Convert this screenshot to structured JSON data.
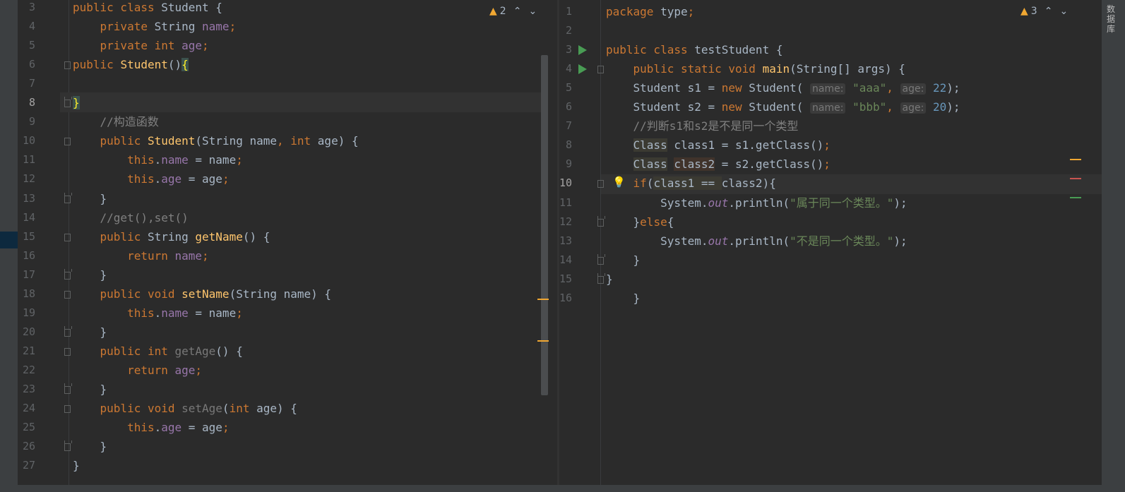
{
  "left_editor": {
    "warning_count": "2",
    "lines": [
      {
        "n": "3",
        "segs": [
          [
            "kw",
            "public class "
          ],
          [
            "",
            "Student {"
          ]
        ]
      },
      {
        "n": "4",
        "segs": [
          [
            "",
            "    "
          ],
          [
            "kw",
            "private "
          ],
          [
            "",
            "String "
          ],
          [
            "fld",
            "name"
          ],
          [
            "kw",
            ";"
          ]
        ]
      },
      {
        "n": "5",
        "segs": [
          [
            "",
            "    "
          ],
          [
            "kw",
            "private int "
          ],
          [
            "fld",
            "age"
          ],
          [
            "kw",
            ";"
          ]
        ]
      },
      {
        "n": "6",
        "segs": [
          [
            "kw",
            "public "
          ],
          [
            "fn",
            "Student"
          ],
          [
            "",
            "()"
          ],
          [
            "brace-hl",
            "{"
          ]
        ]
      },
      {
        "n": "7",
        "segs": [
          [
            "",
            ""
          ]
        ]
      },
      {
        "n": "8",
        "segs": [
          [
            "brace-hl",
            "}"
          ]
        ]
      },
      {
        "n": "9",
        "segs": [
          [
            "",
            "    "
          ],
          [
            "cm",
            "//构造函数"
          ]
        ]
      },
      {
        "n": "10",
        "segs": [
          [
            "",
            "    "
          ],
          [
            "kw",
            "public "
          ],
          [
            "fn",
            "Student"
          ],
          [
            "",
            "(String name"
          ],
          [
            "kw",
            ", int "
          ],
          [
            "",
            "age) {"
          ]
        ]
      },
      {
        "n": "11",
        "segs": [
          [
            "",
            "        "
          ],
          [
            "kw",
            "this"
          ],
          [
            "",
            "."
          ],
          [
            "fld",
            "name"
          ],
          [
            "",
            " = name"
          ],
          [
            "kw",
            ";"
          ]
        ]
      },
      {
        "n": "12",
        "segs": [
          [
            "",
            "        "
          ],
          [
            "kw",
            "this"
          ],
          [
            "",
            "."
          ],
          [
            "fld",
            "age"
          ],
          [
            "",
            " = age"
          ],
          [
            "kw",
            ";"
          ]
        ]
      },
      {
        "n": "13",
        "segs": [
          [
            "",
            "    }"
          ]
        ]
      },
      {
        "n": "14",
        "segs": [
          [
            "",
            "    "
          ],
          [
            "cm",
            "//get(),set()"
          ]
        ]
      },
      {
        "n": "15",
        "segs": [
          [
            "",
            "    "
          ],
          [
            "kw",
            "public "
          ],
          [
            "",
            "String "
          ],
          [
            "fn",
            "getName"
          ],
          [
            "",
            "() {"
          ]
        ]
      },
      {
        "n": "16",
        "segs": [
          [
            "",
            "        "
          ],
          [
            "kw",
            "return "
          ],
          [
            "fld",
            "name"
          ],
          [
            "kw",
            ";"
          ]
        ]
      },
      {
        "n": "17",
        "segs": [
          [
            "",
            "    }"
          ]
        ]
      },
      {
        "n": "18",
        "segs": [
          [
            "",
            "    "
          ],
          [
            "kw",
            "public void "
          ],
          [
            "fn",
            "setName"
          ],
          [
            "",
            "(String name) {"
          ]
        ]
      },
      {
        "n": "19",
        "segs": [
          [
            "",
            "        "
          ],
          [
            "kw",
            "this"
          ],
          [
            "",
            "."
          ],
          [
            "fld",
            "name"
          ],
          [
            "",
            " = name"
          ],
          [
            "kw",
            ";"
          ]
        ]
      },
      {
        "n": "20",
        "segs": [
          [
            "",
            "    }"
          ]
        ]
      },
      {
        "n": "21",
        "segs": [
          [
            "",
            "    "
          ],
          [
            "kw",
            "public int "
          ],
          [
            "gr",
            "getAge"
          ],
          [
            "",
            "() {"
          ]
        ]
      },
      {
        "n": "22",
        "segs": [
          [
            "",
            "        "
          ],
          [
            "kw",
            "return "
          ],
          [
            "fld",
            "age"
          ],
          [
            "kw",
            ";"
          ]
        ]
      },
      {
        "n": "23",
        "segs": [
          [
            "",
            "    }"
          ]
        ]
      },
      {
        "n": "24",
        "segs": [
          [
            "",
            "    "
          ],
          [
            "kw",
            "public void "
          ],
          [
            "gr",
            "setAge"
          ],
          [
            "",
            "("
          ],
          [
            "kw",
            "int "
          ],
          [
            "",
            "age) {"
          ]
        ]
      },
      {
        "n": "25",
        "segs": [
          [
            "",
            "        "
          ],
          [
            "kw",
            "this"
          ],
          [
            "",
            "."
          ],
          [
            "fld",
            "age"
          ],
          [
            "",
            " = age"
          ],
          [
            "kw",
            ";"
          ]
        ]
      },
      {
        "n": "26",
        "segs": [
          [
            "",
            "    }"
          ]
        ]
      },
      {
        "n": "27",
        "segs": [
          [
            "",
            "}"
          ]
        ]
      }
    ]
  },
  "right_editor": {
    "warning_count": "3",
    "lines": [
      {
        "n": "1",
        "segs": [
          [
            "kw",
            "package "
          ],
          [
            "",
            "type"
          ],
          [
            "kw",
            ";"
          ]
        ]
      },
      {
        "n": "2",
        "segs": [
          [
            "",
            ""
          ]
        ]
      },
      {
        "n": "3",
        "segs": [
          [
            "kw",
            "public class "
          ],
          [
            "",
            "testStudent {"
          ]
        ]
      },
      {
        "n": "4",
        "segs": [
          [
            "",
            "    "
          ],
          [
            "kw",
            "public static void "
          ],
          [
            "fn",
            "main"
          ],
          [
            "",
            "(String[] args) {"
          ]
        ]
      },
      {
        "n": "5",
        "segs": [
          [
            "",
            "    Student s1 = "
          ],
          [
            "kw",
            "new "
          ],
          [
            "",
            "Student( "
          ],
          [
            "hint",
            "name:"
          ],
          [
            "",
            " "
          ],
          [
            "str",
            "\"aaa\""
          ],
          [
            "kw",
            ", "
          ],
          [
            "hint",
            "age:"
          ],
          [
            "",
            " "
          ],
          [
            "num",
            "22"
          ],
          [
            "",
            "); "
          ]
        ]
      },
      {
        "n": "6",
        "segs": [
          [
            "",
            "    Student s2 = "
          ],
          [
            "kw",
            "new "
          ],
          [
            "",
            "Student( "
          ],
          [
            "hint",
            "name:"
          ],
          [
            "",
            " "
          ],
          [
            "str",
            "\"bbb\""
          ],
          [
            "kw",
            ", "
          ],
          [
            "hint",
            "age:"
          ],
          [
            "",
            " "
          ],
          [
            "num",
            "20"
          ],
          [
            "",
            "); "
          ]
        ]
      },
      {
        "n": "7",
        "segs": [
          [
            "",
            "    "
          ],
          [
            "cm",
            "//判断s1和s2是不是同一个类型"
          ]
        ]
      },
      {
        "n": "8",
        "segs": [
          [
            "",
            "    "
          ],
          [
            "hl",
            "Class"
          ],
          [
            "",
            " class1 = s1.getClass()"
          ],
          [
            "kw",
            ";"
          ]
        ]
      },
      {
        "n": "9",
        "segs": [
          [
            "",
            "    "
          ],
          [
            "hl",
            "Class"
          ],
          [
            "",
            " "
          ],
          [
            "hl2",
            "class2"
          ],
          [
            "",
            " = s2.getClass()"
          ],
          [
            "kw",
            ";"
          ]
        ]
      },
      {
        "n": "10",
        "segs": [
          [
            "",
            "    "
          ],
          [
            "kw",
            "if"
          ],
          [
            "",
            "("
          ],
          [
            "hl",
            "class1 == "
          ],
          [
            "",
            "class2){"
          ]
        ]
      },
      {
        "n": "11",
        "segs": [
          [
            "",
            "        System."
          ],
          [
            "static",
            "out"
          ],
          [
            "",
            ".println("
          ],
          [
            "str",
            "\"属于同一个类型。\""
          ],
          [
            "",
            "); "
          ]
        ]
      },
      {
        "n": "12",
        "segs": [
          [
            "",
            "    }"
          ],
          [
            "kw",
            "else"
          ],
          [
            "",
            "{"
          ]
        ]
      },
      {
        "n": "13",
        "segs": [
          [
            "",
            "        System."
          ],
          [
            "static",
            "out"
          ],
          [
            "",
            ".println("
          ],
          [
            "str",
            "\"不是同一个类型。\""
          ],
          [
            "",
            "); "
          ]
        ]
      },
      {
        "n": "14",
        "segs": [
          [
            "",
            "    }"
          ]
        ]
      },
      {
        "n": "15",
        "segs": [
          [
            "",
            "}"
          ]
        ]
      },
      {
        "n": "16",
        "segs": [
          [
            "",
            "    }"
          ]
        ]
      }
    ]
  },
  "side_tool_label": "数据库",
  "icons": {
    "warning": "warning-triangle-icon",
    "prev": "chevron-up-icon",
    "next": "chevron-down-icon",
    "run": "run-gutter-icon",
    "bulb": "intention-bulb-icon"
  },
  "colors": {
    "background": "#2b2b2b",
    "keyword": "#cc7832",
    "field": "#9876aa",
    "method": "#ffc66d",
    "string": "#6a8759",
    "number": "#6897bb",
    "comment": "#808080",
    "warning": "#f0a732",
    "run": "#499c54"
  }
}
